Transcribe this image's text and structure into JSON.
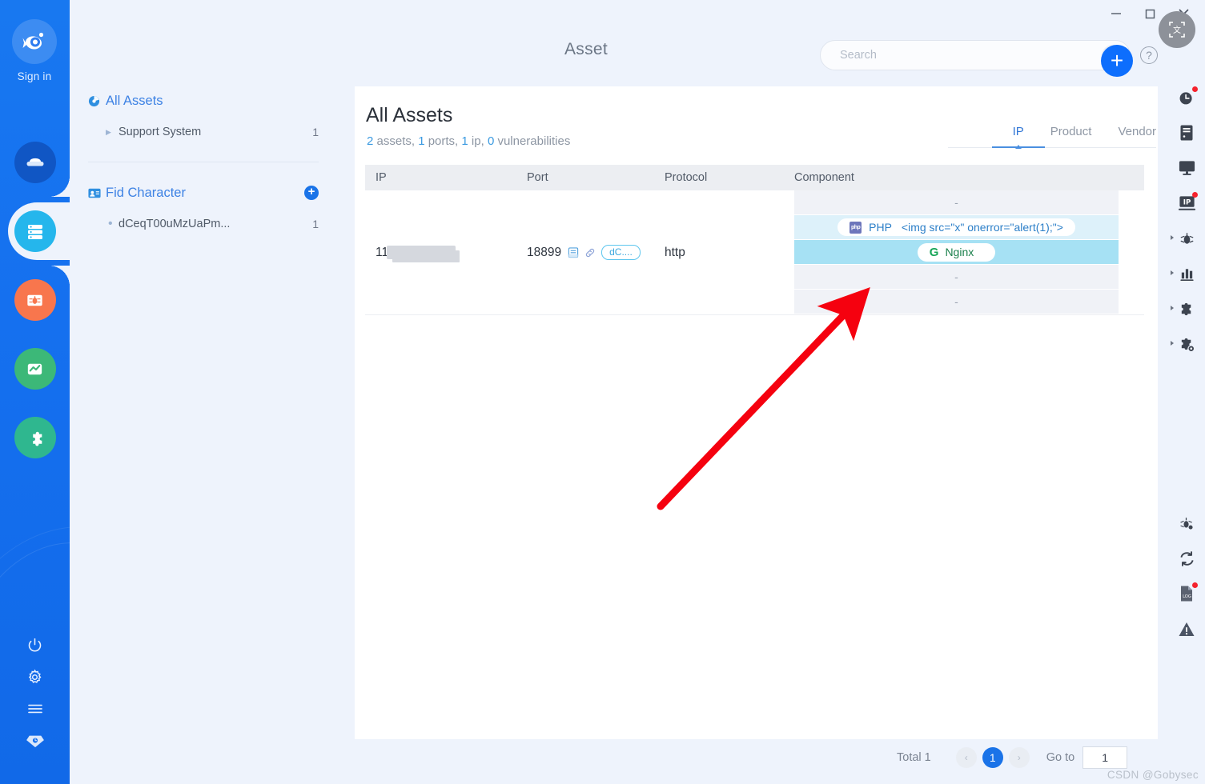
{
  "window": {
    "minimize_label": "–",
    "maximize_label": "□",
    "close_label": "✕",
    "translate_icon": "translate-icon"
  },
  "header": {
    "title": "Asset",
    "search": {
      "value": "",
      "placeholder": "Search",
      "icon": "search-icon"
    },
    "help_label": "?",
    "add_label": "+"
  },
  "rail": {
    "logo_icon": "goby-fish-logo",
    "signin_label": "Sign in",
    "items": [
      {
        "name": "hat-icon",
        "color": "#1056c4",
        "active": false
      },
      {
        "name": "asset-database-icon",
        "color": "#25b6ec",
        "active": true
      },
      {
        "name": "vulnerability-bug-icon",
        "color": "#f8764d",
        "active": false
      },
      {
        "name": "analytics-chart-icon",
        "color": "#3cb878",
        "active": false
      },
      {
        "name": "plugin-puzzle-icon",
        "color": "#2fb78f",
        "active": false
      }
    ],
    "bottom_items": [
      {
        "name": "power-icon"
      },
      {
        "name": "settings-gear-icon"
      },
      {
        "name": "menu-lines-icon"
      },
      {
        "name": "diamond-badge-icon"
      }
    ]
  },
  "leftnav": {
    "groups": [
      {
        "title": "All Assets",
        "icon": "pie-chart-icon",
        "has_add": false,
        "rows": [
          {
            "label": "Support System",
            "count": "1",
            "marker": "caret"
          }
        ]
      },
      {
        "title": "Fid Character",
        "icon": "id-card-icon",
        "has_add": true,
        "add_label": "+",
        "rows": [
          {
            "label": "dCeqT00uMzUaPm...",
            "count": "1",
            "marker": "dot"
          }
        ]
      }
    ]
  },
  "content": {
    "title": "All Assets",
    "summary": {
      "assets_count": "2",
      "assets_label": " assets, ",
      "ports_count": "1",
      "ports_label": " ports, ",
      "ip_count": "1",
      "ip_label": " ip, ",
      "vuln_count": "0",
      "vuln_label": " vulnerabilities"
    },
    "tabs": [
      {
        "label": "IP",
        "active": true
      },
      {
        "label": "Product",
        "active": false
      },
      {
        "label": "Vendor",
        "active": false
      }
    ],
    "table": {
      "columns": [
        "IP",
        "Port",
        "Protocol",
        "Component"
      ],
      "rows": [
        {
          "ip": "11",
          "ip_masked": true,
          "port": "18899",
          "port_icons": [
            "document-list-icon",
            "link-icon"
          ],
          "port_tag": "dC....",
          "protocol": "http",
          "components": [
            {
              "type": "empty",
              "text": "-"
            },
            {
              "type": "chip",
              "highlight": "light",
              "badge": "php-icon",
              "name": "PHP",
              "payload": "<img src=\"x\" onerror=\"alert(1);\">"
            },
            {
              "type": "chip",
              "highlight": "strong",
              "badge": "nginx-g-icon",
              "name": "Nginx",
              "payload": ""
            },
            {
              "type": "empty",
              "text": "-"
            },
            {
              "type": "empty",
              "text": "-"
            }
          ]
        }
      ]
    }
  },
  "pagination": {
    "total_label": "Total 1",
    "prev_label": "‹",
    "current_page": "1",
    "next_label": "›",
    "goto_label": "Go to",
    "goto_value": "1"
  },
  "right_rail": {
    "items": [
      {
        "name": "scan-history-clock-icon",
        "badge": true,
        "caret": false
      },
      {
        "name": "server-icon",
        "badge": false,
        "caret": false
      },
      {
        "name": "monitor-screen-icon",
        "badge": false,
        "caret": false
      },
      {
        "name": "ip-scan-icon",
        "badge": true,
        "caret": false
      },
      {
        "name": "vulnerability-bug-icon",
        "badge": false,
        "caret": true
      },
      {
        "name": "statistics-bar-icon",
        "badge": false,
        "caret": true
      },
      {
        "name": "plugin-puzzle-icon",
        "badge": false,
        "caret": true
      },
      {
        "name": "plugin-settings-icon",
        "badge": false,
        "caret": true
      }
    ],
    "bottom_items": [
      {
        "name": "exploit-spider-icon",
        "badge": false
      },
      {
        "name": "refresh-sync-icon",
        "badge": false
      },
      {
        "name": "log-file-icon",
        "badge": true
      },
      {
        "name": "warning-alert-icon",
        "badge": false
      }
    ]
  },
  "annotation": {
    "type": "red-arrow",
    "watermark": "CSDN @Gobysec"
  },
  "colors": {
    "brand_blue": "#1570ef",
    "accent_blue": "#1a73e8",
    "highlight_light": "#ddf1fa",
    "highlight_strong": "#a6e1f4",
    "annotation_red": "#f5010f"
  }
}
